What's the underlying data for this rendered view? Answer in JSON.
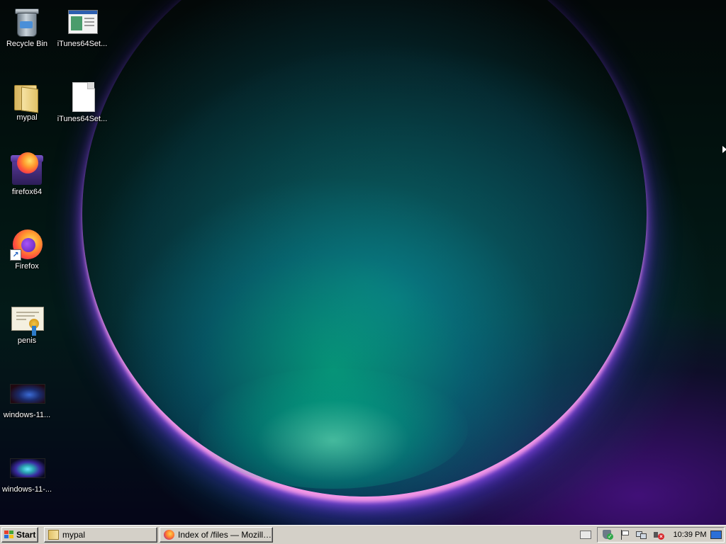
{
  "desktop": {
    "icons": [
      {
        "id": "recycle-bin",
        "label": "Recycle Bin",
        "icon": "recycle-bin-icon"
      },
      {
        "id": "itunes-setup-1",
        "label": "iTunes64Set...",
        "icon": "installer-window-icon"
      },
      {
        "id": "mypal",
        "label": "mypal",
        "icon": "folder-icon"
      },
      {
        "id": "itunes-setup-2",
        "label": "iTunes64Set...",
        "icon": "blank-file-icon"
      },
      {
        "id": "firefox64",
        "label": "firefox64",
        "icon": "firefox-package-icon"
      },
      {
        "id": "firefox",
        "label": "Firefox",
        "icon": "firefox-icon"
      },
      {
        "id": "penis",
        "label": "penis",
        "icon": "certificate-icon"
      },
      {
        "id": "windows-11-a",
        "label": "windows-11...",
        "icon": "image-thumbnail-icon"
      },
      {
        "id": "windows-11-b",
        "label": "windows-11-...",
        "icon": "image-thumbnail-icon"
      }
    ]
  },
  "taskbar": {
    "start_label": "Start",
    "tasks": [
      {
        "label": "mypal",
        "icon": "folder-icon"
      },
      {
        "label": "Index of /files — Mozilla ...",
        "icon": "firefox-icon"
      }
    ],
    "clock": "10:39 PM"
  },
  "colors": {
    "taskbar_bg": "#d4d0c8",
    "wallpaper_accent_green": "#00d28c",
    "wallpaper_accent_purple": "#5a28dc"
  }
}
